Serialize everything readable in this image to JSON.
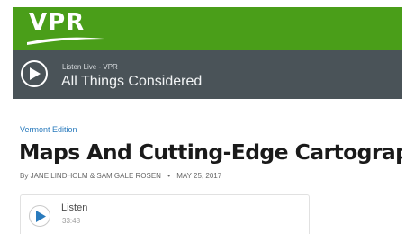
{
  "brand": {
    "logo_text": "VPR",
    "color": "#4a9e19"
  },
  "player": {
    "live_label": "Listen Live - VPR",
    "show_title": "All Things Considered",
    "play_icon": "play-icon",
    "background": "#4a5358"
  },
  "article": {
    "kicker": "Vermont Edition",
    "headline": "Maps And Cutting-Edge Cartography",
    "byline_prefix": "By",
    "authors": "JANE LINDHOLM & SAM GALE ROSEN",
    "separator": "•",
    "date": "MAY 25, 2017"
  },
  "audio": {
    "label": "Listen",
    "duration": "33:48",
    "accent": "#2a7bbd"
  }
}
